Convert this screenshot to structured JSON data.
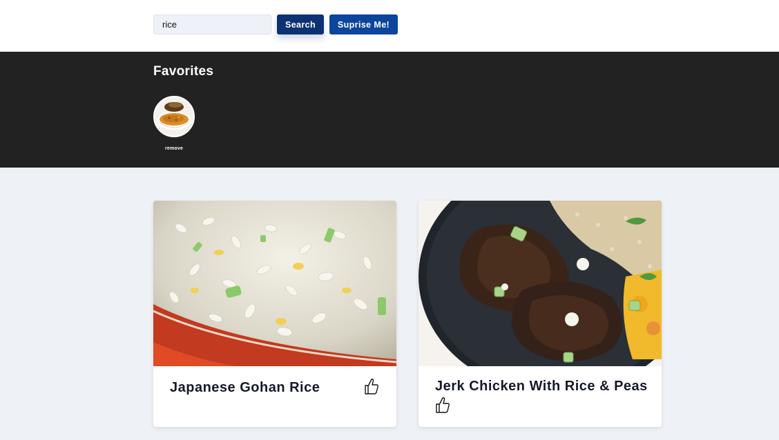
{
  "search": {
    "value": "rice",
    "button_label": "Search",
    "surprise_label": "Suprise Me!"
  },
  "favorites": {
    "title": "Favorites",
    "items": [
      {
        "remove_label": "remove",
        "image_icon": "soup-bowl-image"
      }
    ]
  },
  "recipes": [
    {
      "title": "Japanese Gohan Rice",
      "image": "fried-rice-photo",
      "like_icon": "thumbs-up-icon"
    },
    {
      "title": "Jerk Chicken With Rice & Peas",
      "image": "jerk-chicken-photo",
      "like_icon": "thumbs-up-icon"
    }
  ],
  "colors": {
    "search_button": "#0c3274",
    "surprise_button": "#0b459c",
    "favorites_bg": "#222222",
    "page_bg": "#eef1f6"
  }
}
